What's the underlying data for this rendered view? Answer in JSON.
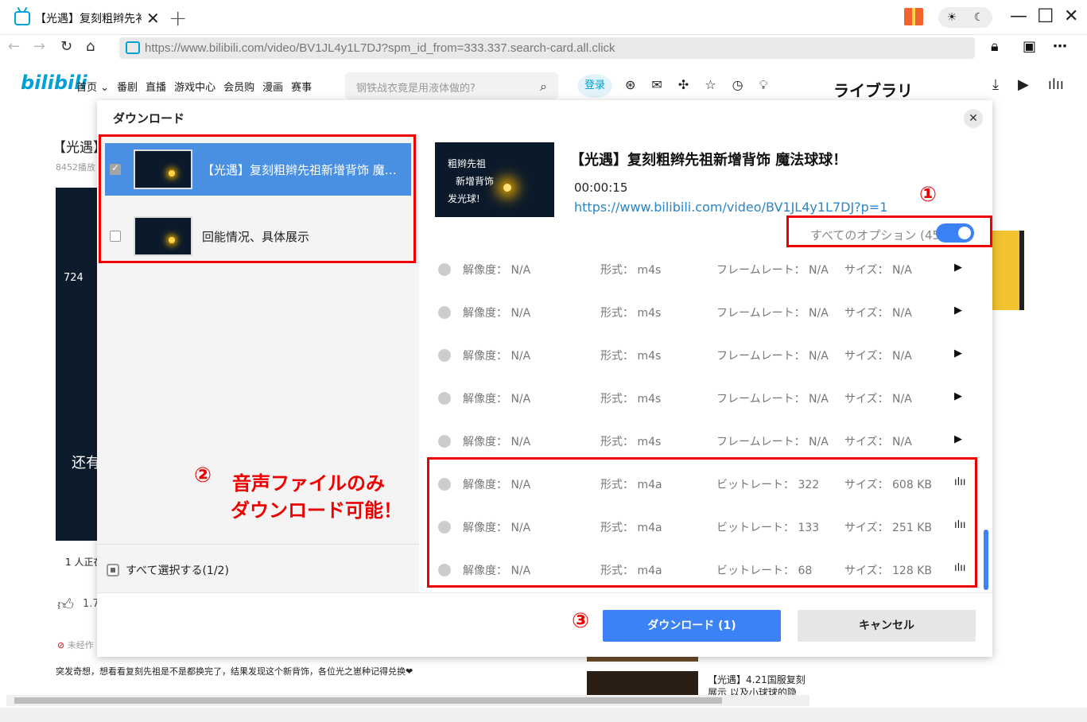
{
  "browser": {
    "tab_title": "【光遇】复刻粗辫先衤",
    "tab_close": "✕",
    "new_tab": "+",
    "url": "https://www.bilibili.com/video/BV1JL4y1L7DJ?spm_id_from=333.337.search-card.all.click"
  },
  "site": {
    "logo": "bilibili",
    "nav": [
      "首页 ⌄",
      "番剧",
      "直播",
      "游戏中心",
      "会员购",
      "漫画",
      "赛事"
    ],
    "search_placeholder": "钢铁战衣竟是用液体做的?",
    "login": "登录",
    "page_title_snippet": "【光遇】",
    "views_snippet": "8452播放",
    "likes_snippet": "1.7",
    "viewers_snippet": "1 人正在",
    "counter_snippet": "724",
    "overlay_snippet": "还有",
    "unverified_snippet": "未经作",
    "description": "突发奇想，想看看复刻先祖是不是都换完了，结果发现这个新背饰，各位光之崽种记得兑换❤",
    "related_title": "【光遇】4.21国服复刻",
    "related_sub": "展示 以及小球球的隐"
  },
  "library": {
    "title": "ライブラリ"
  },
  "modal": {
    "title": "ダウンロード",
    "close": "✕",
    "items": [
      {
        "label": "【光遇】复刻粗辫先祖新增背饰 魔…",
        "checked": true
      },
      {
        "label": "回能情况、具体展示",
        "checked": false
      }
    ],
    "select_all": "すべて選択する(1/2)",
    "video_title": "【光遇】复刻粗辫先祖新增背饰 魔法球球！",
    "duration": "00:00:15",
    "video_url": "https://www.bilibili.com/video/BV1JL4y1L7DJ?p=1",
    "thumb_text": [
      "粗辫先祖",
      "新增背饰",
      "发光球!"
    ],
    "all_options_label": "すべてのオプション (45)",
    "rows": [
      {
        "res": "解像度： N/A",
        "fmt": "形式： m4s",
        "third": "フレームレート： N/A",
        "size": "サイズ： N/A",
        "icon": "▶"
      },
      {
        "res": "解像度： N/A",
        "fmt": "形式： m4s",
        "third": "フレームレート： N/A",
        "size": "サイズ： N/A",
        "icon": "▶"
      },
      {
        "res": "解像度： N/A",
        "fmt": "形式： m4s",
        "third": "フレームレート： N/A",
        "size": "サイズ： N/A",
        "icon": "▶"
      },
      {
        "res": "解像度： N/A",
        "fmt": "形式： m4s",
        "third": "フレームレート： N/A",
        "size": "サイズ： N/A",
        "icon": "▶"
      },
      {
        "res": "解像度： N/A",
        "fmt": "形式： m4s",
        "third": "フレームレート： N/A",
        "size": "サイズ： N/A",
        "icon": "▶"
      },
      {
        "res": "解像度： N/A",
        "fmt": "形式： m4a",
        "third": "ビットレート： 322",
        "size": "サイズ： 608 KB",
        "icon": "ılıı"
      },
      {
        "res": "解像度： N/A",
        "fmt": "形式： m4a",
        "third": "ビットレート： 133",
        "size": "サイズ： 251 KB",
        "icon": "ılıı"
      },
      {
        "res": "解像度： N/A",
        "fmt": "形式： m4a",
        "third": "ビットレート： 68",
        "size": "サイズ： 128 KB",
        "icon": "ılıı"
      }
    ],
    "download_button": "ダウンロード (1)",
    "cancel_button": "キャンセル"
  },
  "annotations": {
    "one": "①",
    "two": "②",
    "two_text_line1": "音声ファイルのみ",
    "two_text_line2": "ダウンロード可能！",
    "three": "③"
  },
  "colors": {
    "accent": "#3b82f6",
    "annotation_red": "#e00000",
    "bili_blue": "#00a1d6"
  }
}
